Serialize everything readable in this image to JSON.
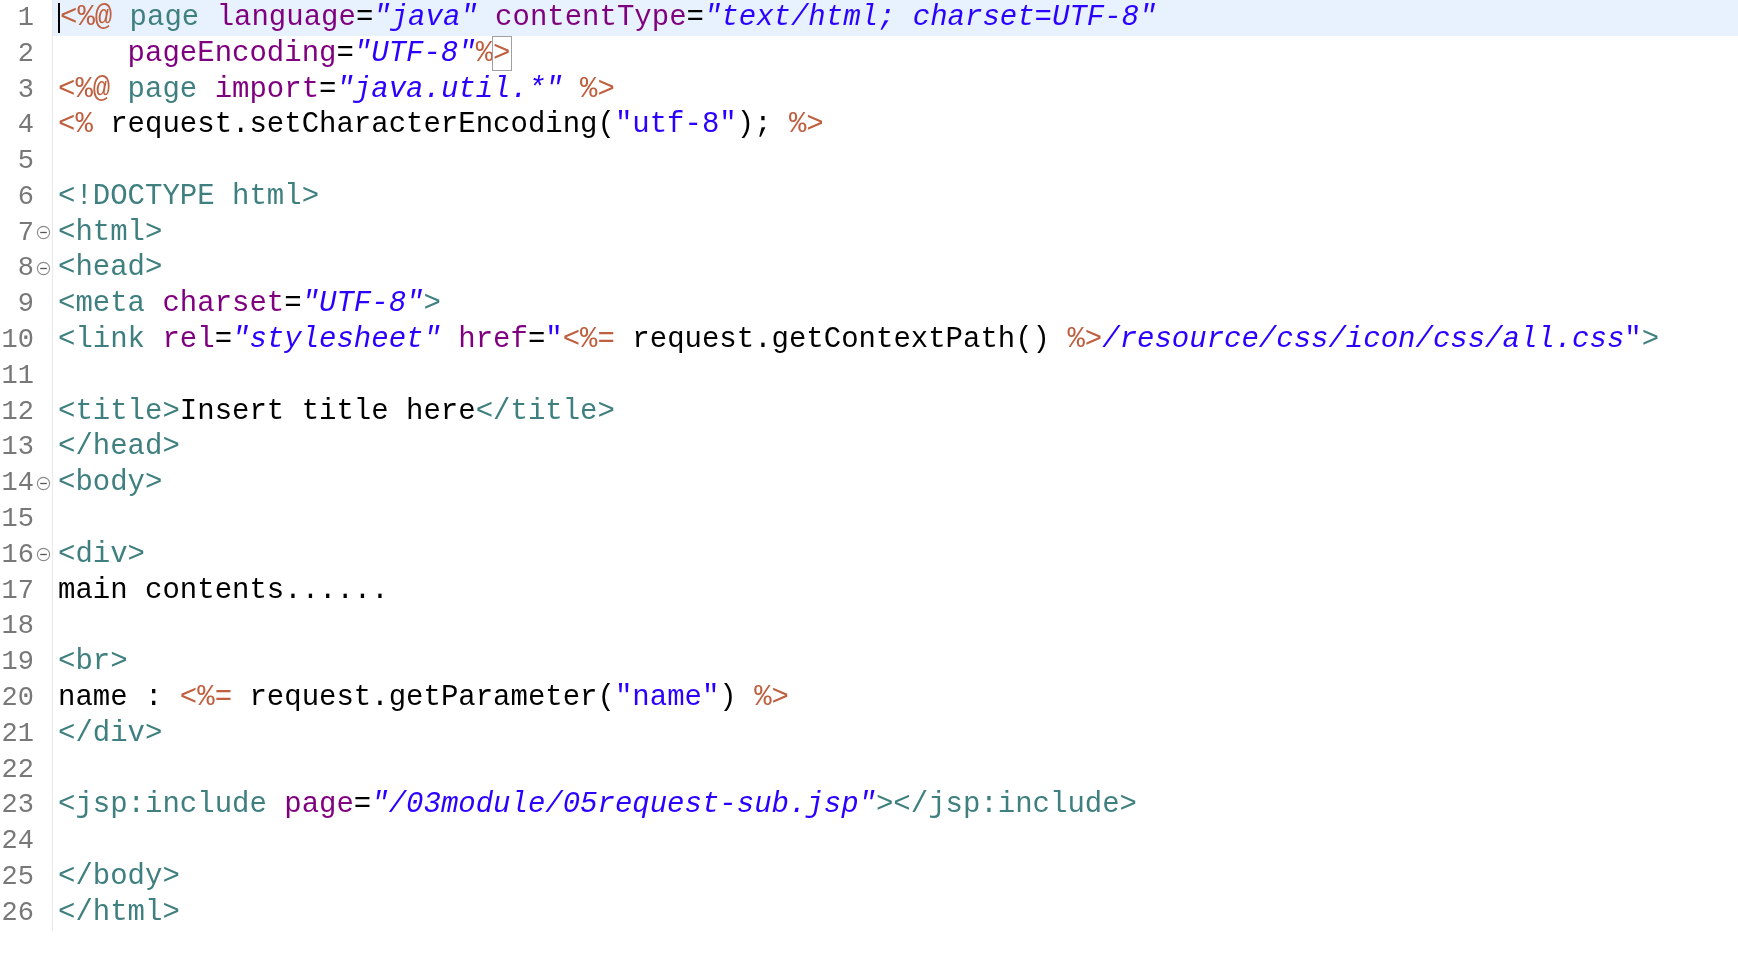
{
  "editor": {
    "lines": [
      {
        "number": "1",
        "selected": true,
        "foldable": false,
        "tokens": [
          {
            "kind": "jsp",
            "text": "<%@"
          },
          {
            "kind": "directive",
            "text": " page"
          },
          {
            "kind": "attr",
            "text": " language"
          },
          {
            "kind": "plain",
            "text": "="
          },
          {
            "kind": "str",
            "text": "\"java\""
          },
          {
            "kind": "attr",
            "text": " contentType"
          },
          {
            "kind": "plain",
            "text": "="
          },
          {
            "kind": "str",
            "text": "\"text/html; charset=UTF-8\""
          }
        ]
      },
      {
        "number": "2",
        "selected": false,
        "foldable": false,
        "tokens": [
          {
            "kind": "attr",
            "text": "    pageEncoding"
          },
          {
            "kind": "plain",
            "text": "="
          },
          {
            "kind": "str",
            "text": "\"UTF-8\""
          },
          {
            "kind": "jsp",
            "text": "%"
          },
          {
            "kind": "jsp",
            "text": ">",
            "matched": true
          }
        ]
      },
      {
        "number": "3",
        "selected": false,
        "foldable": false,
        "tokens": [
          {
            "kind": "jsp",
            "text": "<%@"
          },
          {
            "kind": "directive",
            "text": " page"
          },
          {
            "kind": "attr",
            "text": " import"
          },
          {
            "kind": "plain",
            "text": "="
          },
          {
            "kind": "str",
            "text": "\"java.util.*\""
          },
          {
            "kind": "jsp",
            "text": " %>"
          }
        ]
      },
      {
        "number": "4",
        "selected": false,
        "foldable": false,
        "tokens": [
          {
            "kind": "jsp",
            "text": "<%"
          },
          {
            "kind": "plain",
            "text": " request.setCharacterEncoding("
          },
          {
            "kind": "jstr",
            "text": "\"utf-8\""
          },
          {
            "kind": "plain",
            "text": "); "
          },
          {
            "kind": "jsp",
            "text": "%>"
          }
        ]
      },
      {
        "number": "5",
        "selected": false,
        "foldable": false
      },
      {
        "number": "6",
        "selected": false,
        "foldable": false,
        "tokens": [
          {
            "kind": "tag",
            "text": "<!DOCTYPE html>"
          }
        ]
      },
      {
        "number": "7",
        "selected": false,
        "foldable": true,
        "tokens": [
          {
            "kind": "tag",
            "text": "<html>"
          }
        ]
      },
      {
        "number": "8",
        "selected": false,
        "foldable": true,
        "tokens": [
          {
            "kind": "tag",
            "text": "<head>"
          }
        ]
      },
      {
        "number": "9",
        "selected": false,
        "foldable": false,
        "tokens": [
          {
            "kind": "tag",
            "text": "<meta"
          },
          {
            "kind": "attr",
            "text": " charset"
          },
          {
            "kind": "plain",
            "text": "="
          },
          {
            "kind": "str",
            "text": "\"UTF-8\""
          },
          {
            "kind": "tag",
            "text": ">"
          }
        ]
      },
      {
        "number": "10",
        "selected": false,
        "foldable": false,
        "tokens": [
          {
            "kind": "tag",
            "text": "<link"
          },
          {
            "kind": "attr",
            "text": " rel"
          },
          {
            "kind": "plain",
            "text": "="
          },
          {
            "kind": "str",
            "text": "\"stylesheet\""
          },
          {
            "kind": "attr",
            "text": " href"
          },
          {
            "kind": "plain",
            "text": "="
          },
          {
            "kind": "jstr",
            "text": "\""
          },
          {
            "kind": "jsp",
            "text": "<%="
          },
          {
            "kind": "plain",
            "text": " request.getContextPath() "
          },
          {
            "kind": "jsp",
            "text": "%>"
          },
          {
            "kind": "str",
            "text": "/resource/css/icon/css/all.css"
          },
          {
            "kind": "jstr",
            "text": "\""
          },
          {
            "kind": "tag",
            "text": ">"
          }
        ]
      },
      {
        "number": "11",
        "selected": false,
        "foldable": false
      },
      {
        "number": "12",
        "selected": false,
        "foldable": false,
        "tokens": [
          {
            "kind": "tag",
            "text": "<title>"
          },
          {
            "kind": "plain",
            "text": "Insert title here"
          },
          {
            "kind": "tag",
            "text": "</title>"
          }
        ]
      },
      {
        "number": "13",
        "selected": false,
        "foldable": false,
        "tokens": [
          {
            "kind": "tag",
            "text": "</head>"
          }
        ]
      },
      {
        "number": "14",
        "selected": false,
        "foldable": true,
        "tokens": [
          {
            "kind": "tag",
            "text": "<body>"
          }
        ]
      },
      {
        "number": "15",
        "selected": false,
        "foldable": false
      },
      {
        "number": "16",
        "selected": false,
        "foldable": true,
        "tokens": [
          {
            "kind": "tag",
            "text": "<div>"
          }
        ]
      },
      {
        "number": "17",
        "selected": false,
        "foldable": false,
        "tokens": [
          {
            "kind": "plain",
            "text": "main contents......"
          }
        ]
      },
      {
        "number": "18",
        "selected": false,
        "foldable": false
      },
      {
        "number": "19",
        "selected": false,
        "foldable": false,
        "tokens": [
          {
            "kind": "tag",
            "text": "<br>"
          }
        ]
      },
      {
        "number": "20",
        "selected": false,
        "foldable": false,
        "tokens": [
          {
            "kind": "plain",
            "text": "name : "
          },
          {
            "kind": "jsp",
            "text": "<%="
          },
          {
            "kind": "plain",
            "text": " request.getParameter("
          },
          {
            "kind": "jstr",
            "text": "\"name\""
          },
          {
            "kind": "plain",
            "text": ") "
          },
          {
            "kind": "jsp",
            "text": "%>"
          }
        ]
      },
      {
        "number": "21",
        "selected": false,
        "foldable": false,
        "tokens": [
          {
            "kind": "tag",
            "text": "</div>"
          }
        ]
      },
      {
        "number": "22",
        "selected": false,
        "foldable": false
      },
      {
        "number": "23",
        "selected": false,
        "foldable": false,
        "tokens": [
          {
            "kind": "tag",
            "text": "<jsp:include"
          },
          {
            "kind": "attr",
            "text": " page"
          },
          {
            "kind": "plain",
            "text": "="
          },
          {
            "kind": "str",
            "text": "\"/03module/05request-sub.jsp\""
          },
          {
            "kind": "tag",
            "text": "></jsp:include>"
          }
        ]
      },
      {
        "number": "24",
        "selected": false,
        "foldable": false
      },
      {
        "number": "25",
        "selected": false,
        "foldable": false,
        "tokens": [
          {
            "kind": "tag",
            "text": "</body>"
          }
        ]
      },
      {
        "number": "26",
        "selected": false,
        "foldable": false,
        "tokens": [
          {
            "kind": "tag",
            "text": "</html>"
          }
        ]
      }
    ]
  }
}
